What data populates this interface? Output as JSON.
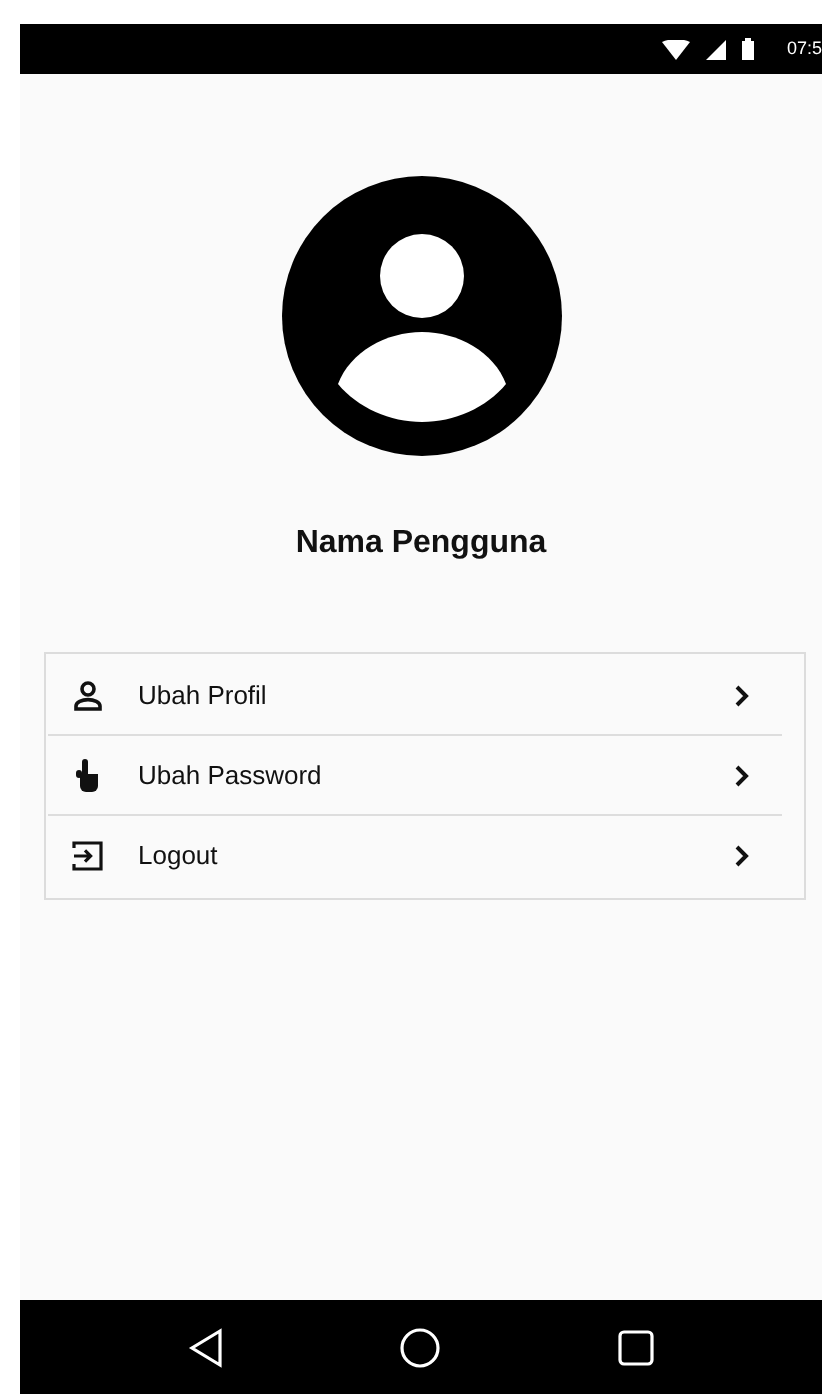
{
  "status_bar": {
    "time": "07:5"
  },
  "profile": {
    "name": "Nama Pengguna"
  },
  "menu": [
    {
      "label": "Ubah Profil"
    },
    {
      "label": "Ubah Password"
    },
    {
      "label": "Logout"
    }
  ]
}
